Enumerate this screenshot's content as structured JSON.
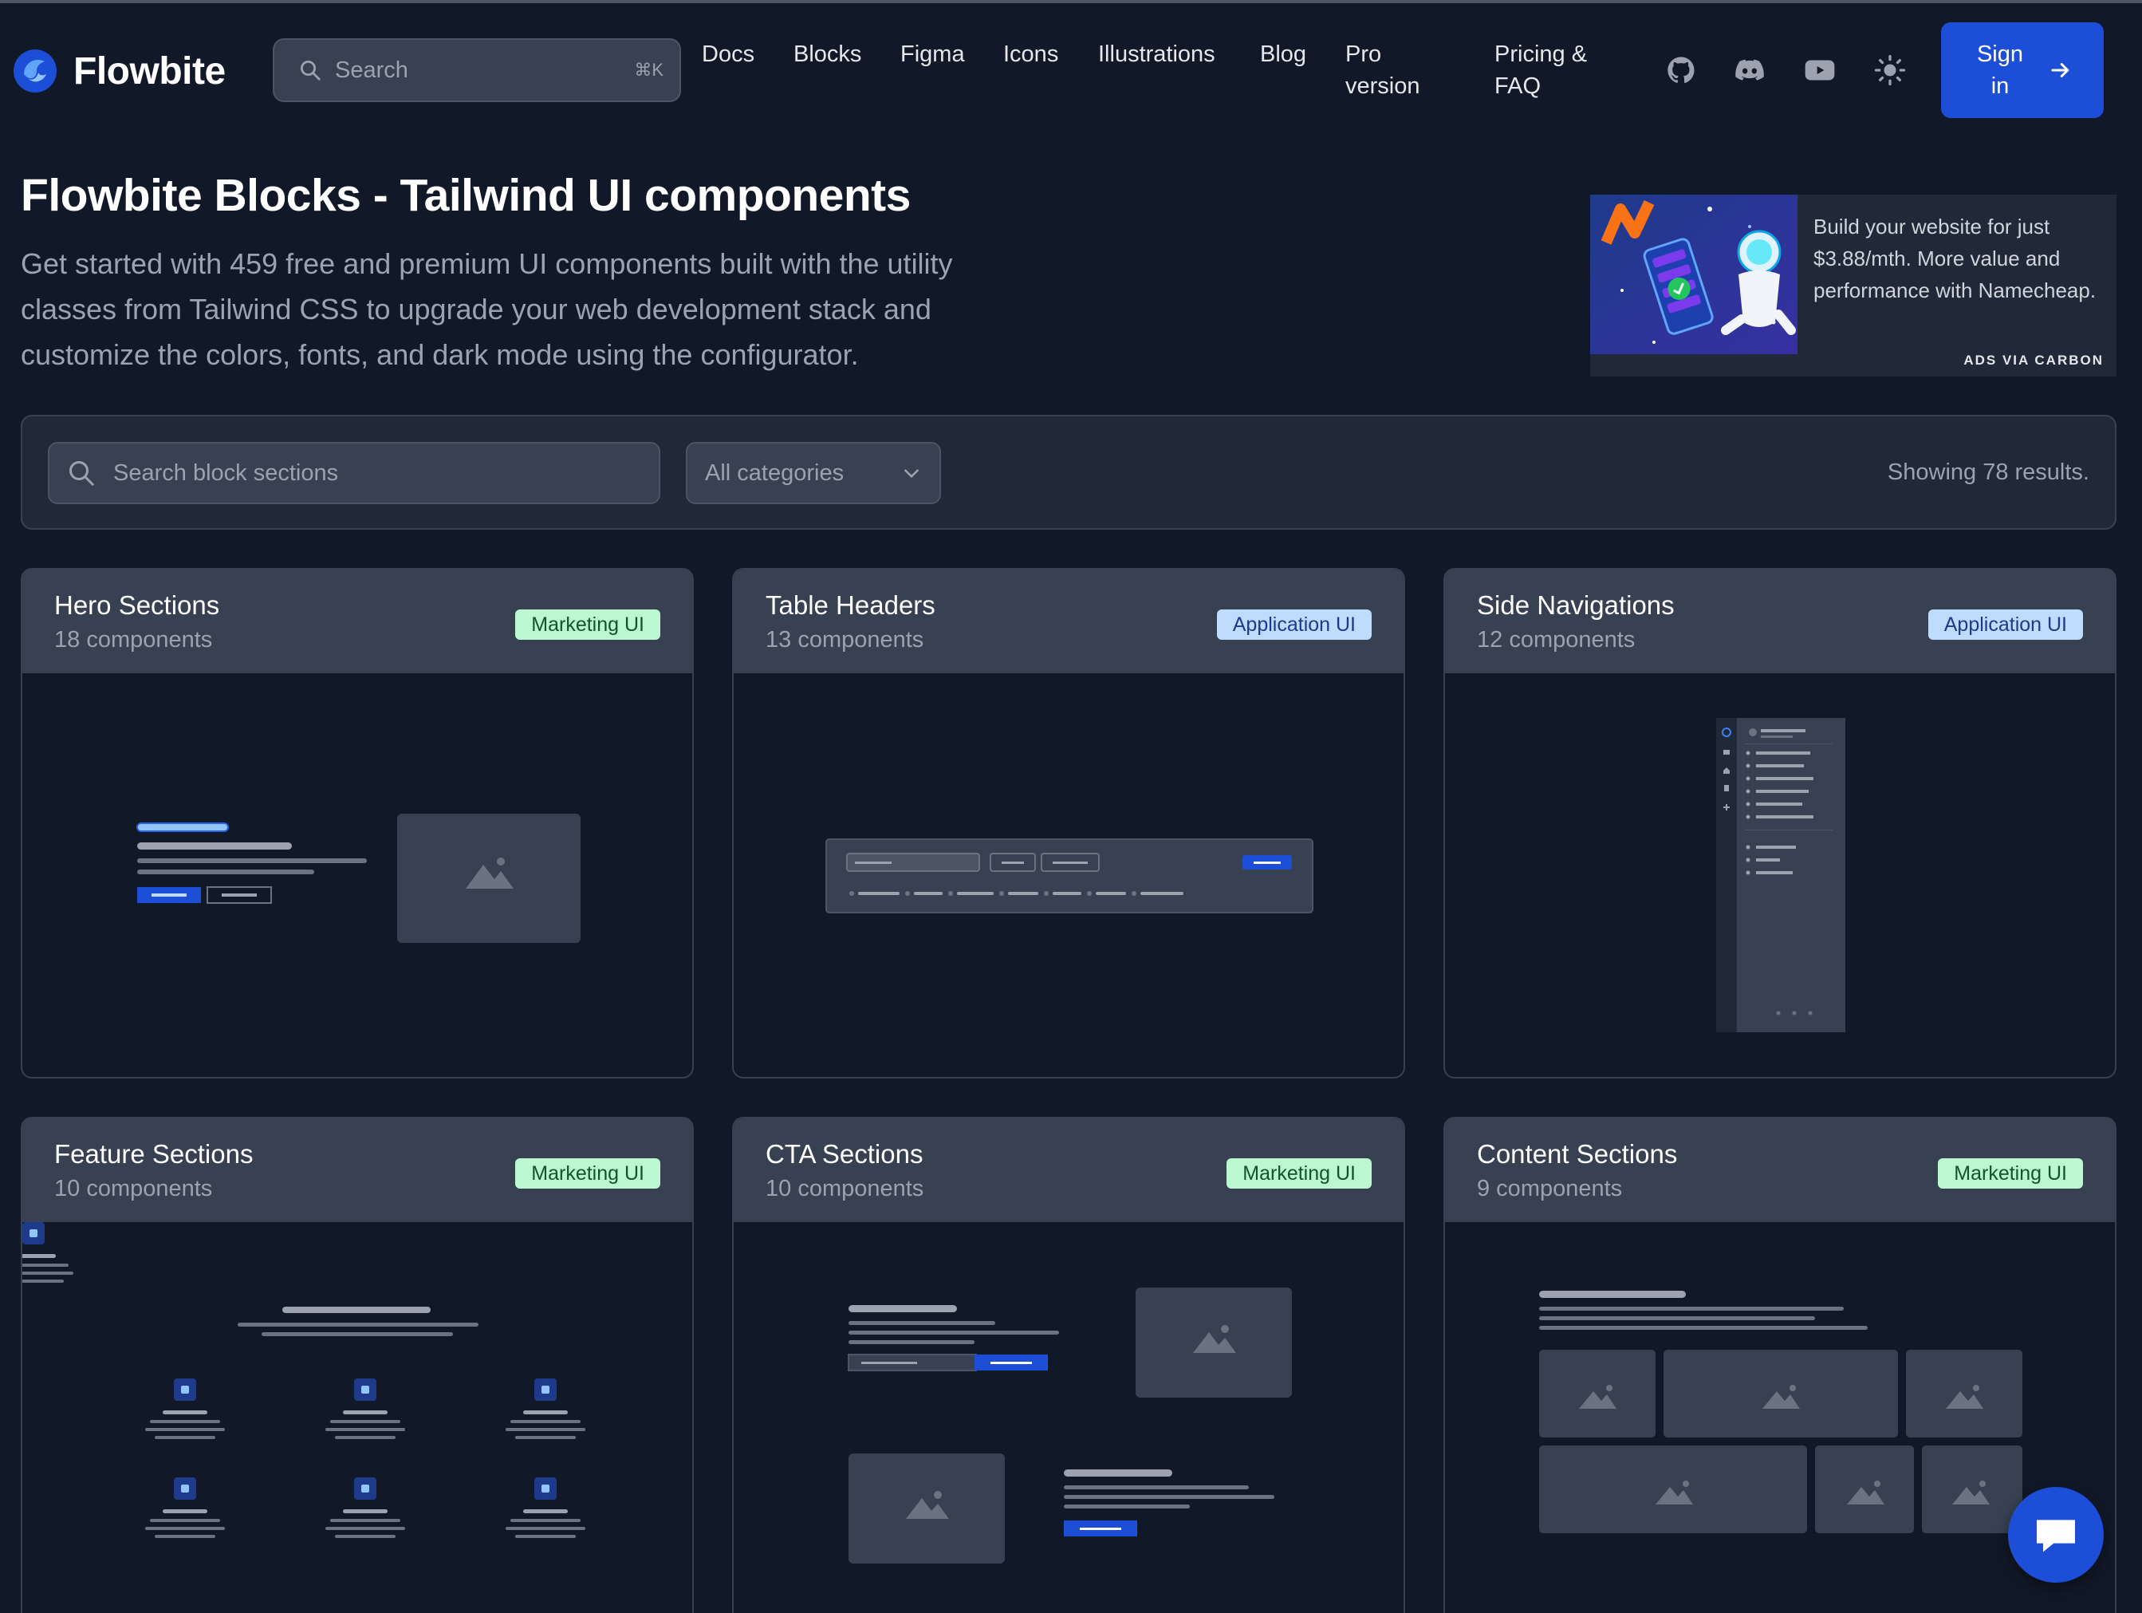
{
  "brand": {
    "name": "Flowbite"
  },
  "nav": {
    "search_placeholder": "Search",
    "search_shortcut": "⌘K",
    "links": [
      "Docs",
      "Blocks",
      "Figma",
      "Icons",
      "Illustrations",
      "Blog"
    ],
    "pro": [
      "Pro",
      "version"
    ],
    "pricing": [
      "Pricing &",
      "FAQ"
    ],
    "signin": [
      "Sign",
      "in"
    ]
  },
  "hero": {
    "title": "Flowbite Blocks - Tailwind UI components",
    "description": "Get started with 459 free and premium UI components built with the utility classes from Tailwind CSS to upgrade your web development stack and customize the colors, fonts, and dark mode using the configurator."
  },
  "ad": {
    "text": "Build your website for just $3.88/mth. More value and performance with Namecheap.",
    "via": "ADS VIA CARBON"
  },
  "filters": {
    "search_placeholder": "Search block sections",
    "category": "All categories",
    "results": "Showing 78 results."
  },
  "cards": [
    {
      "title": "Hero Sections",
      "count": "18 components",
      "badge": "Marketing UI"
    },
    {
      "title": "Table Headers",
      "count": "13 components",
      "badge": "Application UI"
    },
    {
      "title": "Side Navigations",
      "count": "12 components",
      "badge": "Application UI"
    },
    {
      "title": "Feature Sections",
      "count": "10 components",
      "badge": "Marketing UI"
    },
    {
      "title": "CTA Sections",
      "count": "10 components",
      "badge": "Marketing UI"
    },
    {
      "title": "Content Sections",
      "count": "9 components",
      "badge": "Marketing UI"
    }
  ],
  "colors": {
    "background": "#111827",
    "panel": "#1f2937",
    "accent": "#1d4ed8",
    "badge_marketing": "#bbf7d0",
    "badge_application": "#bfdbfe"
  }
}
